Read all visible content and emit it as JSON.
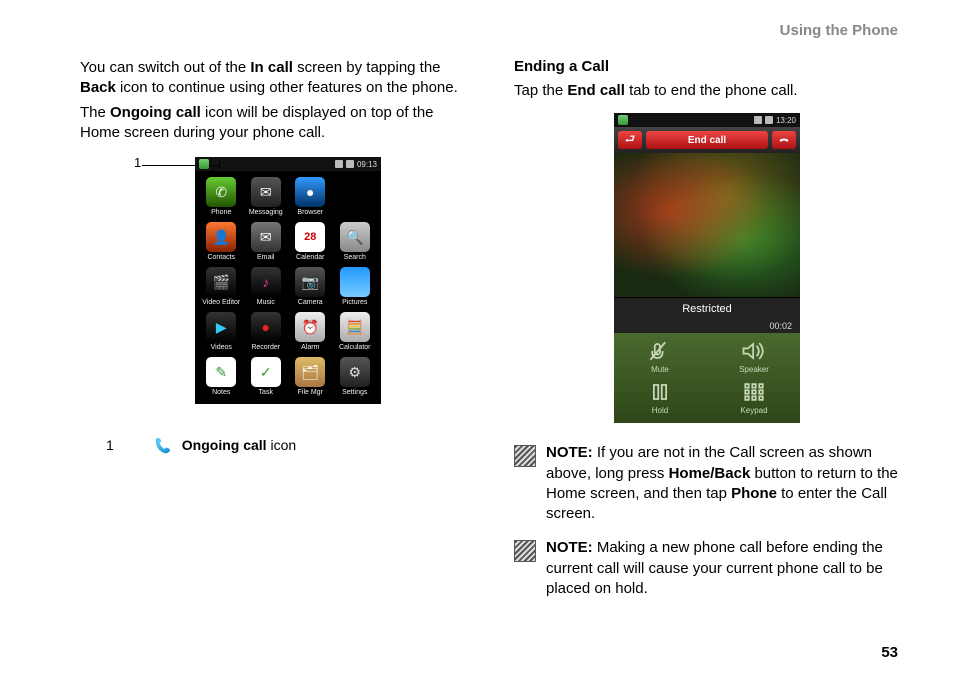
{
  "header": {
    "title": "Using the Phone"
  },
  "page_number": "53",
  "left": {
    "p1_a": "You can switch out of the ",
    "p1_b": "In call",
    "p1_c": " screen by tapping the ",
    "p1_d": "Back",
    "p1_e": " icon to continue using other features on the phone.",
    "p2_a": "The ",
    "p2_b": "Ongoing call",
    "p2_c": " icon will be displayed on top of the Home screen during your phone call.",
    "callout": "1",
    "legend_num": "1",
    "legend_bold": "Ongoing call",
    "legend_rest": " icon"
  },
  "phone1": {
    "time": "09:13",
    "apps": [
      {
        "label": "Phone",
        "cls": "phone-i",
        "glyph": "✆"
      },
      {
        "label": "Messaging",
        "cls": "msg-i",
        "glyph": "✉"
      },
      {
        "label": "Browser",
        "cls": "browser-i",
        "glyph": "●"
      },
      {
        "label": "",
        "cls": "",
        "glyph": ""
      },
      {
        "label": "Contacts",
        "cls": "cont-i",
        "glyph": "👤"
      },
      {
        "label": "Email",
        "cls": "email-i",
        "glyph": "✉"
      },
      {
        "label": "Calendar",
        "cls": "cal-i",
        "glyph": "28"
      },
      {
        "label": "Search",
        "cls": "search-i",
        "glyph": "🔍"
      },
      {
        "label": "Video Editor",
        "cls": "vedit-i",
        "glyph": "🎬"
      },
      {
        "label": "Music",
        "cls": "music-i",
        "glyph": "♪"
      },
      {
        "label": "Camera",
        "cls": "camera-i",
        "glyph": "📷"
      },
      {
        "label": "Pictures",
        "cls": "pic-i",
        "glyph": ""
      },
      {
        "label": "Videos",
        "cls": "vid-i",
        "glyph": "▶"
      },
      {
        "label": "Recorder",
        "cls": "rec-i",
        "glyph": "●"
      },
      {
        "label": "Alarm",
        "cls": "alarm-i",
        "glyph": "⏰"
      },
      {
        "label": "Calculator",
        "cls": "calc-i",
        "glyph": "🧮"
      },
      {
        "label": "Notes",
        "cls": "notes-i",
        "glyph": "✎"
      },
      {
        "label": "Task",
        "cls": "task-i",
        "glyph": "✓"
      },
      {
        "label": "File Mgr",
        "cls": "fmgr-i",
        "glyph": "🗂"
      },
      {
        "label": "Settings",
        "cls": "set-i",
        "glyph": "⚙"
      }
    ]
  },
  "right": {
    "h": "Ending a Call",
    "p_a": "Tap the ",
    "p_b": "End call",
    "p_c": " tab to end the phone call.",
    "note1_a": "NOTE:",
    "note1_b": " If you are not in the Call screen as shown above, long press ",
    "note1_c": "Home/Back",
    "note1_d": " button to return to the Home screen, and then tap ",
    "note1_e": "Phone",
    "note1_f": " to enter the Call screen.",
    "note2_a": "NOTE:",
    "note2_b": " Making a new phone call before ending the current call will cause your current phone call to be placed on hold."
  },
  "phone2": {
    "time": "13:20",
    "endcall": "End call",
    "restricted": "Restricted",
    "timer": "00:02",
    "btns": {
      "mute": "Mute",
      "speaker": "Speaker",
      "hold": "Hold",
      "keypad": "Keypad"
    }
  }
}
